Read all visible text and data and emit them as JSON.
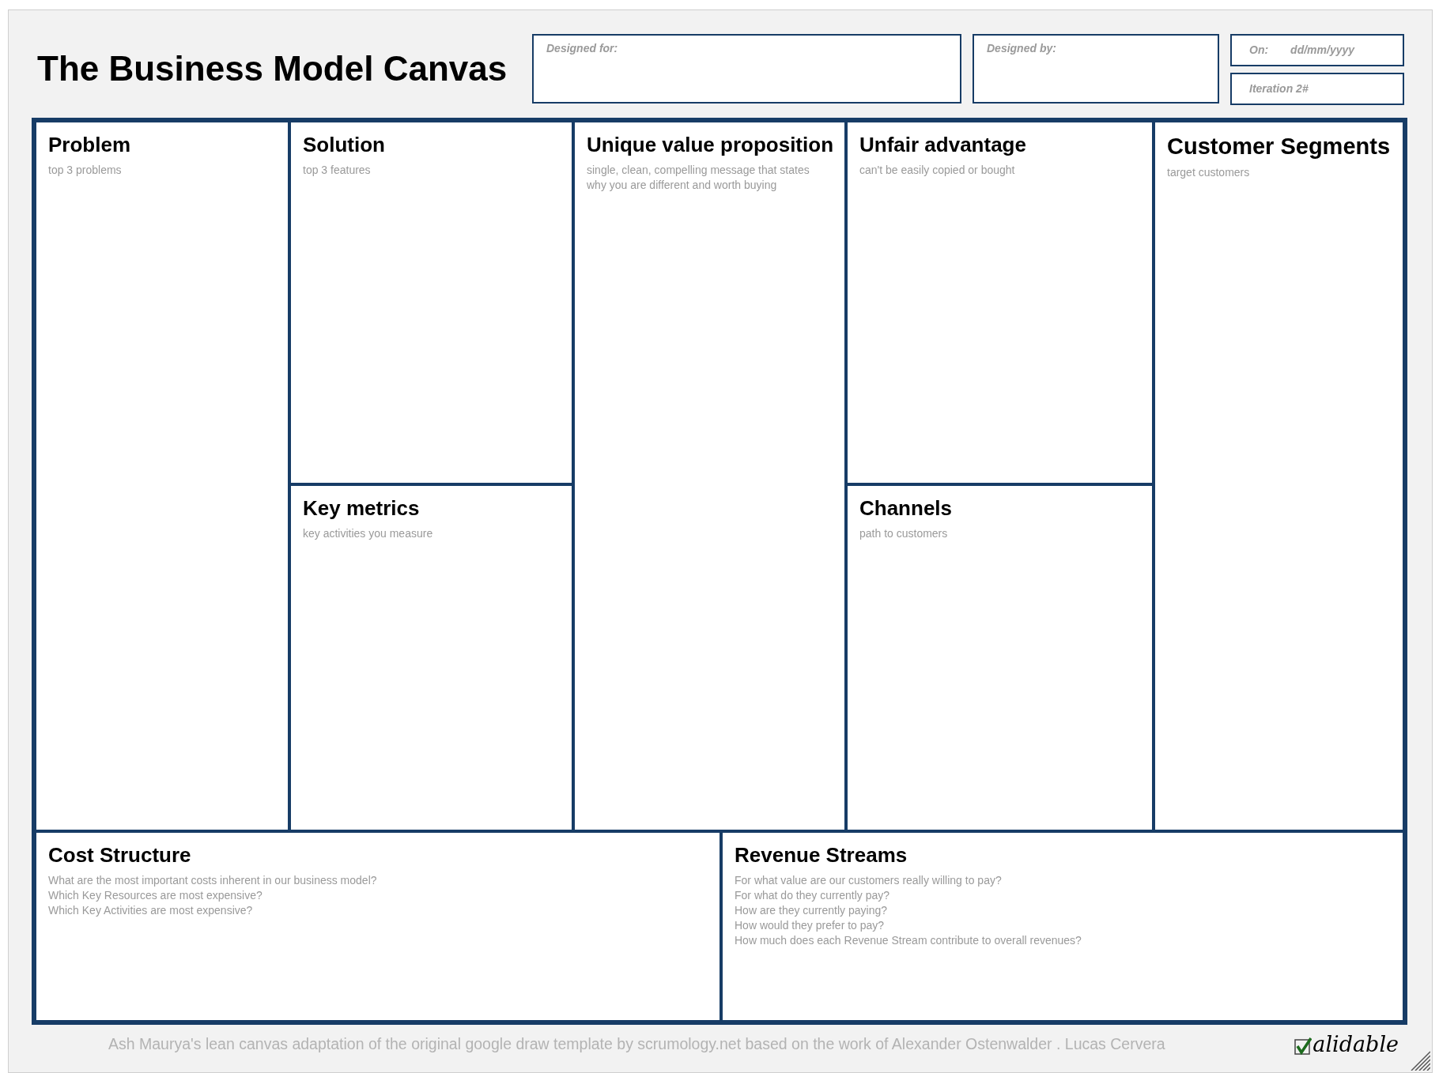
{
  "title": "The Business Model Canvas",
  "header_fields": [
    {
      "label": "Designed for:"
    },
    {
      "label": "Designed by:"
    }
  ],
  "date_field": {
    "label": "On:",
    "placeholder": "dd/mm/yyyy"
  },
  "iteration_field": {
    "label": "Iteration 2#"
  },
  "top_blocks": [
    {
      "title": "Problem",
      "hint": [
        "top 3 problems"
      ]
    },
    {
      "title": "Solution",
      "hint": [
        "top 3 features"
      ]
    },
    {
      "title": "Key metrics",
      "hint": [
        "key activities you measure"
      ]
    },
    {
      "title": "Unique value proposition",
      "hint": [
        "single, clean, compelling message that states",
        "why you are different and worth buying"
      ]
    },
    {
      "title": "Unfair advantage",
      "hint": [
        "can't be easily copied or bought"
      ]
    },
    {
      "title": "Channels",
      "hint": [
        "path to customers"
      ]
    },
    {
      "title": "Customer Segments",
      "hint": [
        "target customers"
      ]
    }
  ],
  "bottom_blocks": [
    {
      "title": "Cost Structure",
      "hint": [
        "What are the most important costs inherent in our business model?",
        "Which Key Resources are most expensive?",
        "Which Key Activities are most expensive?"
      ]
    },
    {
      "title": "Revenue Streams",
      "hint": [
        "For what value are our customers really willing to pay?",
        "For what do they currently pay?",
        "How are they currently paying?",
        "How would they prefer to pay?",
        "How much does each Revenue Stream contribute to overall revenues?"
      ]
    }
  ],
  "footer": "Ash Maurya's lean canvas adaptation of the original google draw template by scrumology.net based on the work of Alexander Ostenwalder . Lucas Cervera",
  "logo": "alidable"
}
